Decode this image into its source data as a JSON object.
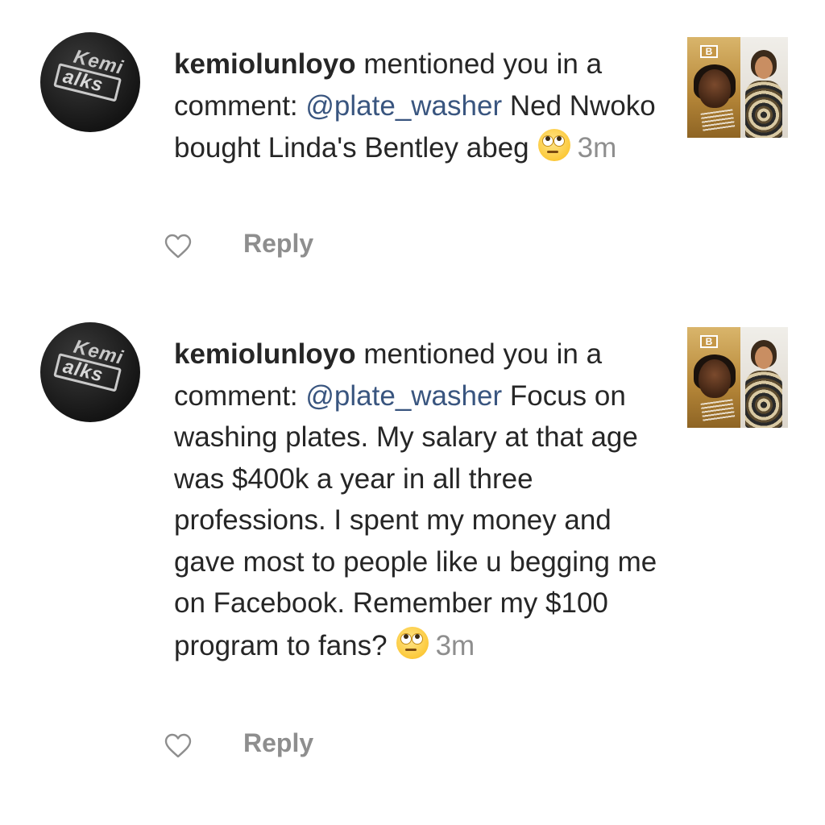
{
  "notifications": [
    {
      "avatar_text": {
        "line1": "Kemi",
        "line2": "alks"
      },
      "username": "kemiolunloyo",
      "action": "mentioned you in a comment:",
      "mention": "@plate_washer",
      "comment": "Ned Nwoko bought Linda's Bentley abeg",
      "emoji": "face-with-rolling-eyes",
      "time": "3m",
      "thumbnail_badge": "B",
      "reply_label": "Reply"
    },
    {
      "avatar_text": {
        "line1": "Kemi",
        "line2": "alks"
      },
      "username": "kemiolunloyo",
      "action": "mentioned you in a comment:",
      "mention": "@plate_washer",
      "comment": "Focus on washing plates. My salary at that age was $400k a year in all three professions. I spent my money and gave most to people like u begging me on Facebook. Remember my $100 program to fans?",
      "emoji": "face-with-rolling-eyes",
      "time": "3m",
      "thumbnail_badge": "B",
      "reply_label": "Reply"
    }
  ],
  "icons": {
    "like": "heart-outline-icon"
  },
  "colors": {
    "mention": "#39557f",
    "muted": "#8e8e8e",
    "text": "#262626"
  }
}
